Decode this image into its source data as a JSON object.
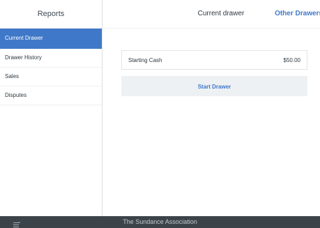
{
  "sidebar": {
    "title": "Reports",
    "items": [
      {
        "label": "Current Drawer",
        "active": true
      },
      {
        "label": "Drawer History",
        "active": false
      },
      {
        "label": "Sales",
        "active": false
      },
      {
        "label": "Disputes",
        "active": false
      }
    ]
  },
  "main": {
    "title": "Current drawer",
    "other_drawers_label": "Other Drawers",
    "starting_cash": {
      "label": "Starting Cash",
      "value": "$50.00"
    },
    "start_button_label": "Start Drawer"
  },
  "footer": {
    "text": "The Sundance Association",
    "menu_icon": "hamburger-menu-icon"
  },
  "colors": {
    "accent": "#3f78c8",
    "footer_bg": "#3c4349",
    "button_bg": "#eef1f3"
  }
}
